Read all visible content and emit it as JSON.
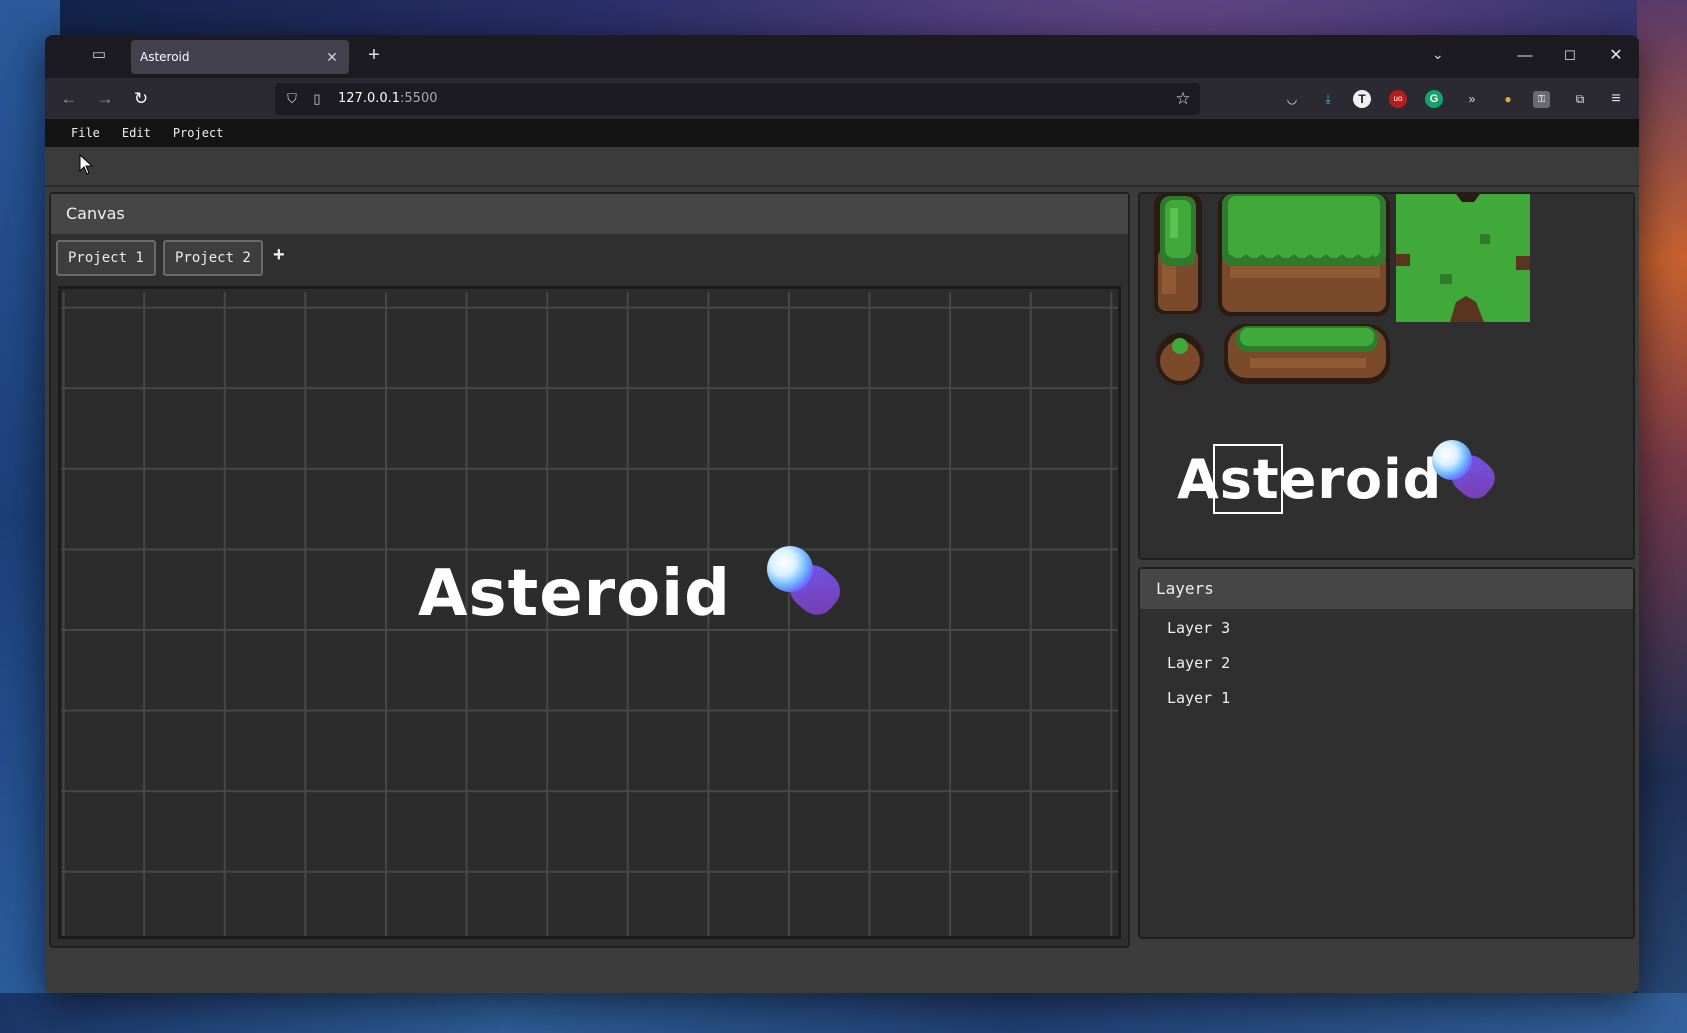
{
  "browser": {
    "tab_title": "Asteroid",
    "url_host": "127.0.0.1",
    "url_port": ":5500",
    "close_glyph": "✕",
    "new_tab_glyph": "+"
  },
  "menu": {
    "items": [
      "File",
      "Edit",
      "Project"
    ]
  },
  "canvas": {
    "header": "Canvas",
    "project_tabs": [
      "Project 1",
      "Project 2"
    ],
    "add_tab_glyph": "+",
    "logo_text": "Asteroid"
  },
  "spritesheet": {
    "logo_text": "Asteroid"
  },
  "layers": {
    "header": "Layers",
    "items": [
      "Layer 3",
      "Layer 2",
      "Layer 1"
    ]
  },
  "colors": {
    "grass": "#3fa93a",
    "dirt": "#7a4a2a",
    "panel_bg": "#2f2f2f",
    "header_bg": "#464646"
  },
  "icons": {
    "toolbar": [
      "tab-overview-icon",
      "back-arrow-icon",
      "forward-arrow-icon",
      "reload-icon",
      "shield-icon",
      "page-icon",
      "star-icon"
    ],
    "extensions": [
      "pocket-icon",
      "download-icon",
      "t-extension-icon",
      "ublock-icon",
      "grammarly-icon",
      "forward-skip-icon",
      "cat-extension-icon",
      "key-extension-icon",
      "puzzle-icon",
      "hamburger-menu-icon"
    ]
  }
}
